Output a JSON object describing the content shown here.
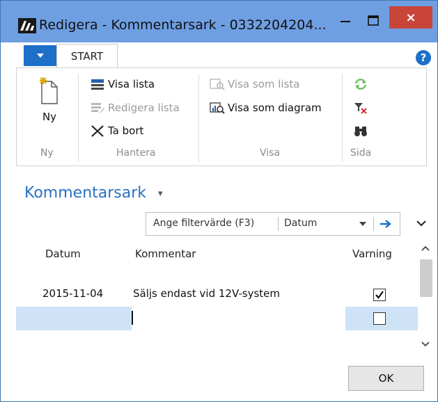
{
  "window": {
    "title": "Redigera - Kommentarsark - 0332204204..."
  },
  "titlebar_buttons": {
    "close": "×"
  },
  "tabs": {
    "start": "START"
  },
  "help": {
    "label": "?"
  },
  "ribbon": {
    "ny": {
      "button": "Ny",
      "group": "Ny"
    },
    "hantera": {
      "group": "Hantera",
      "visa_lista": "Visa lista",
      "redigera_lista": "Redigera lista",
      "ta_bort": "Ta bort"
    },
    "visa": {
      "group": "Visa",
      "visa_som_lista": "Visa som lista",
      "visa_som_diagram": "Visa som diagram"
    },
    "sida": {
      "group": "Sida"
    }
  },
  "page": {
    "title": "Kommentarsark",
    "title_caret": "▾"
  },
  "filter": {
    "placeholder": "Ange filtervärde (F3)",
    "field": "Datum"
  },
  "table": {
    "headers": [
      "Datum",
      "Kommentar",
      "Varning"
    ],
    "rows": [
      {
        "datum": "2015-11-04",
        "kommentar": "Säljs endast vid 12V-system",
        "varning": true
      },
      {
        "datum": "",
        "kommentar": "",
        "varning": false
      }
    ]
  },
  "footer": {
    "ok": "OK"
  },
  "colors": {
    "titlebar": "#6f9fe3",
    "accent": "#1e6fc8",
    "close": "#c9453a",
    "selection": "#cfe3f7"
  }
}
